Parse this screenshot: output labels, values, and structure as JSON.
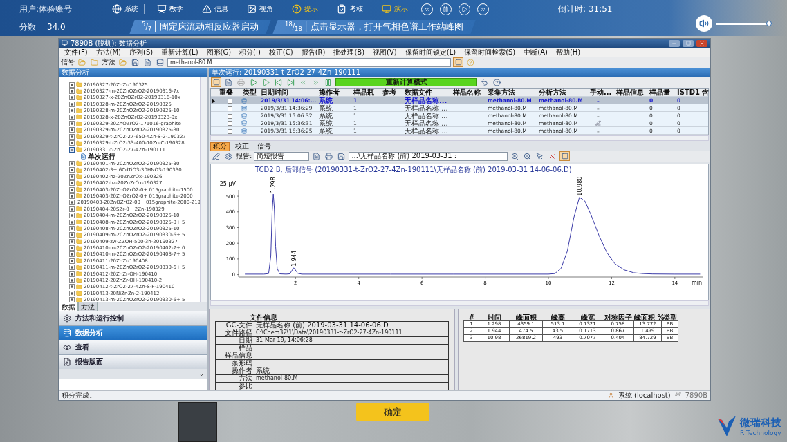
{
  "hud": {
    "user": "用户:体验账号",
    "score_label": "分数",
    "score": "34.0",
    "nav": [
      {
        "label": "系统",
        "highlighted": false
      },
      {
        "label": "教学",
        "highlighted": false
      },
      {
        "label": "信息",
        "highlighted": false
      },
      {
        "label": "视角",
        "highlighted": false
      },
      {
        "label": "提示",
        "highlighted": true
      },
      {
        "label": "考核",
        "highlighted": false
      },
      {
        "label": "演示",
        "highlighted": true
      }
    ],
    "countdown": "倒计时: 31:51",
    "steps": [
      {
        "fraction": "$^{5}$/$_{7}$",
        "text": "固定床流动相反应器启动"
      },
      {
        "fraction": "$^{18}$/$_{18}$",
        "text": "点击显示器，打开气相色谱工作站峰图"
      }
    ],
    "volume": {
      "level": 0.95
    }
  },
  "window": {
    "title": "7890B (脱机): 数据分析",
    "menu": [
      "文件(F)",
      "方法(M)",
      "序列(S)",
      "重新计算(L)",
      "图形(G)",
      "积分(I)",
      "校正(C)",
      "报告(R)",
      "批处理(B)",
      "视图(V)",
      "保留时间锁定(L)",
      "保留时间检索(S)",
      "中断(A)",
      "帮助(H)"
    ],
    "toolbar": {
      "signal_label": "信号",
      "method_label": "方法",
      "method_value": "methanol-80.M"
    },
    "left_panel": {
      "title": "数据分析",
      "tree": [
        {
          "label": "20190327-20ZnZr-190325",
          "expanded": false
        },
        {
          "label": "20190327-m-20ZnOZrO2-20190316-7x",
          "expanded": false
        },
        {
          "label": "20190327-x-20ZnOZrO2-20190316-10x",
          "expanded": false
        },
        {
          "label": "20190328-m-20ZnOZrO2-20190325",
          "expanded": false
        },
        {
          "label": "20190328-m-20ZnOZrO2-20190325-10",
          "expanded": false
        },
        {
          "label": "20190328-x-20ZnOZrO2-20190323-9x",
          "expanded": false
        },
        {
          "label": "20190329-20ZnOZrO2-171016-graphite",
          "expanded": false
        },
        {
          "label": "20190329-m-20ZnOZrO2-20190325-30",
          "expanded": false
        },
        {
          "label": "20190329-t-ZrO2-27-650-4Zn-S-2-190327",
          "expanded": false
        },
        {
          "label": "20190329-t-ZrO2-33-400-10Zn-C-190328",
          "expanded": false
        },
        {
          "label": "20190331-t-ZrO2-27-4Zn-190111",
          "expanded": true,
          "children": [
            {
              "label": "单次运行"
            }
          ]
        },
        {
          "label": "20190401-m-20ZnOZrO2-20190325-30",
          "expanded": false
        },
        {
          "label": "20190402-3+ 6CdTiO3-30HNO3-190330",
          "expanded": false
        },
        {
          "label": "20190402-hz-20ZnZrOx-190326",
          "expanded": false
        },
        {
          "label": "20190402-hz-20ZnZrOx-190327",
          "expanded": false
        },
        {
          "label": "20190403-20ZnOZrO2-0+ 015graphite-1500",
          "expanded": false
        },
        {
          "label": "20190403-20ZnOZrO2-0+ 015graphite-2000",
          "expanded": false
        },
        {
          "label": "20190403-20ZnOZrO2-00+ 015graphite-2000-219",
          "expanded": false
        },
        {
          "label": "20190404-20SZr-0+ 2Zn-190329",
          "expanded": false
        },
        {
          "label": "20190404-m-20ZnOZrO2-20190325-10",
          "expanded": false
        },
        {
          "label": "20190408-m-20ZnOZrO2-20190325-0+ 5",
          "expanded": false
        },
        {
          "label": "20190408-m-20ZnOZrO2-20190325-10",
          "expanded": false
        },
        {
          "label": "20190409-m-20ZnOZrO2-20190330-6+ 5",
          "expanded": false
        },
        {
          "label": "20190409-zw-ZZOH-500-3h-20190327",
          "expanded": false
        },
        {
          "label": "20190410-m-20ZnOZrO2-20190402-7+ 0",
          "expanded": false
        },
        {
          "label": "20190410-m-20ZnOZrO2-20190408-7+ 5",
          "expanded": false
        },
        {
          "label": "20190411-20ZnZr-190408",
          "expanded": false
        },
        {
          "label": "20190411-m-20ZnOZrO2-20190330-6+ 5",
          "expanded": false
        },
        {
          "label": "20190412-20ZnZr-OH-190410",
          "expanded": false
        },
        {
          "label": "20190412-20ZnZr-OH-190410-2",
          "expanded": false
        },
        {
          "label": "20190412-t-ZrO2-27-4Zn-S-F-190410",
          "expanded": false
        },
        {
          "label": "20190413-20NiZr-Zn-2-190412",
          "expanded": false
        },
        {
          "label": "20190413-m-20ZnOZrO2-20190330-6+ 5",
          "expanded": false
        }
      ],
      "tabs": [
        {
          "label": "数据",
          "selected": true
        },
        {
          "label": "方法",
          "selected": false
        }
      ],
      "nav": [
        {
          "label": "方法和运行控制",
          "selected": false
        },
        {
          "label": "数据分析",
          "selected": true
        },
        {
          "label": "查看",
          "selected": false
        },
        {
          "label": "报告版面",
          "selected": false
        }
      ]
    },
    "run": {
      "title": "单次运行: 20190331-t-ZrO2-27-4Zn-190111",
      "mode": "重新计算模式",
      "table": {
        "columns": [
          "重叠",
          "类型",
          "日期时间",
          "操作者",
          "样品瓶",
          "参考",
          "数据文件",
          "样品名称",
          "采集方法",
          "分析方法",
          "手动...",
          "样品信息",
          "样品量",
          "ISTD1 含"
        ],
        "rows": [
          {
            "selected": true,
            "overlay": false,
            "datetime": "2019/3/31 14:06:...",
            "operator": "系统",
            "vial": "1",
            "datafile": "无样品名称...",
            "acq_method": "methanol-80.M",
            "analysis_method": "methanol-80.M",
            "manual": "–",
            "manual_edited": false,
            "amount": "0",
            "istd": "0"
          },
          {
            "selected": false,
            "overlay": false,
            "datetime": "2019/3/31 14:36:29",
            "operator": "系统",
            "vial": "1",
            "datafile": "无样品名称 ...",
            "acq_method": "methanol-80.M",
            "analysis_method": "methanol-80.M",
            "manual": "–",
            "manual_edited": false,
            "amount": "0",
            "istd": "0"
          },
          {
            "selected": false,
            "overlay": false,
            "datetime": "2019/3/31 15:06:32",
            "operator": "系统",
            "vial": "1",
            "datafile": "无样品名称 ...",
            "acq_method": "methanol-80.M",
            "analysis_method": "methanol-80.M",
            "manual": "–",
            "manual_edited": false,
            "amount": "0",
            "istd": "0"
          },
          {
            "selected": false,
            "overlay": false,
            "datetime": "2019/3/31 15:36:31",
            "operator": "系统",
            "vial": "1",
            "datafile": "无样品名称 ...",
            "acq_method": "methanol-80.M",
            "analysis_method": "methanol-80.M",
            "manual_edited": true,
            "amount": "0",
            "istd": "0"
          },
          {
            "selected": false,
            "overlay": false,
            "datetime": "2019/3/31 16:36:25",
            "operator": "系统",
            "vial": "1",
            "datafile": "无样品名称 ...",
            "acq_method": "methanol-80.M",
            "analysis_method": "methanol-80.M",
            "manual": "–",
            "manual_edited": false,
            "amount": "0",
            "istd": "0"
          }
        ]
      }
    },
    "chart_tabs": [
      {
        "label": "积分",
        "selected": true
      },
      {
        "label": "校正",
        "selected": false
      },
      {
        "label": "信号",
        "selected": false
      }
    ],
    "chart_toolbar": {
      "report_label": "报告:",
      "report_value": "简短报告",
      "file_value": "...\\无样品名称 (前) 2019-03-31 :"
    },
    "chart": {
      "title": "TCD2 B, 后部信号 (20190331-t-ZrO2-27-4Zn-190111\\无样品名称 (前) 2019-03-31 14-06-06.D)",
      "chart_data": {
        "type": "line",
        "xlabel": "min",
        "ylabel": "25 µV",
        "x": [
          0.4,
          1.0,
          1.15,
          1.22,
          1.26,
          1.298,
          1.33,
          1.37,
          1.42,
          1.5,
          1.7,
          1.82,
          1.9,
          1.944,
          1.99,
          2.07,
          2.2,
          3,
          5,
          7,
          9,
          10,
          10.2,
          10.4,
          10.6,
          10.8,
          10.98,
          11.15,
          11.35,
          11.6,
          11.85,
          12.1,
          12.4,
          12.7,
          13,
          13.3,
          14,
          14.8
        ],
        "series": [
          {
            "color": "#3c3ca8",
            "values": [
              3,
              3,
              6,
              120,
              400,
              513,
              420,
              180,
              40,
              5,
              3,
              5,
              30,
              43,
              32,
              8,
              3,
              3,
              3,
              3,
              3,
              3,
              6,
              40,
              150,
              360,
              493,
              470,
              380,
              250,
              140,
              70,
              30,
              12,
              6,
              4,
              3,
              3
            ]
          }
        ],
        "xlim": [
          0.2,
          14.9
        ],
        "ylim": [
          -15,
          540
        ],
        "xticks": [
          2,
          4,
          6,
          8,
          10,
          12,
          14
        ],
        "yticks": [
          0,
          100,
          200,
          300,
          400,
          500
        ],
        "annotations": [
          {
            "x": 1.298,
            "y": 513,
            "text": "1.298"
          },
          {
            "x": 1.944,
            "y": 43,
            "text": "1.944"
          },
          {
            "x": 10.98,
            "y": 493,
            "text": "10.980"
          }
        ]
      }
    },
    "file_info": {
      "title": "文件信息",
      "rows": [
        {
          "label": "GC-文件",
          "value": "无样品名称 (前) 2019-03-31 14-06-06.D"
        },
        {
          "label": "文件路径",
          "value": "C:\\Chem32\\1\\Data\\20190331-t-ZrO2-27-4Zn-190111"
        },
        {
          "label": "日期",
          "value": "31-Mar-19, 14:06:28"
        },
        {
          "label": "样品"
        },
        {
          "label": "样品信息"
        },
        {
          "label": "条形码"
        },
        {
          "label": "操作者",
          "value": "系统"
        },
        {
          "label": "方法",
          "value": "methanol-80.M"
        },
        {
          "label": "参比"
        }
      ]
    },
    "peak_table": {
      "columns": [
        "#",
        "时间",
        "峰面积",
        "峰高",
        "峰宽",
        "对称因子",
        "峰面积 %",
        "类型"
      ],
      "rows": [
        [
          "1",
          "1.298",
          "4359.1",
          "513.1",
          "0.1321",
          "0.758",
          "13.772",
          "BB"
        ],
        [
          "2",
          "1.944",
          "474.5",
          "43.5",
          "0.1713",
          "0.867",
          "1.499",
          "BB"
        ],
        [
          "3",
          "10.98",
          "26819.2",
          "493",
          "0.7077",
          "0.404",
          "84.729",
          "BB"
        ]
      ]
    },
    "status_bar": {
      "message": "积分完成。",
      "user": "系统 (localhost)",
      "instrument": "7890B"
    }
  },
  "confirm_button": "确定",
  "logo": {
    "name": "微瑞科技",
    "tagline": "R Technology"
  }
}
